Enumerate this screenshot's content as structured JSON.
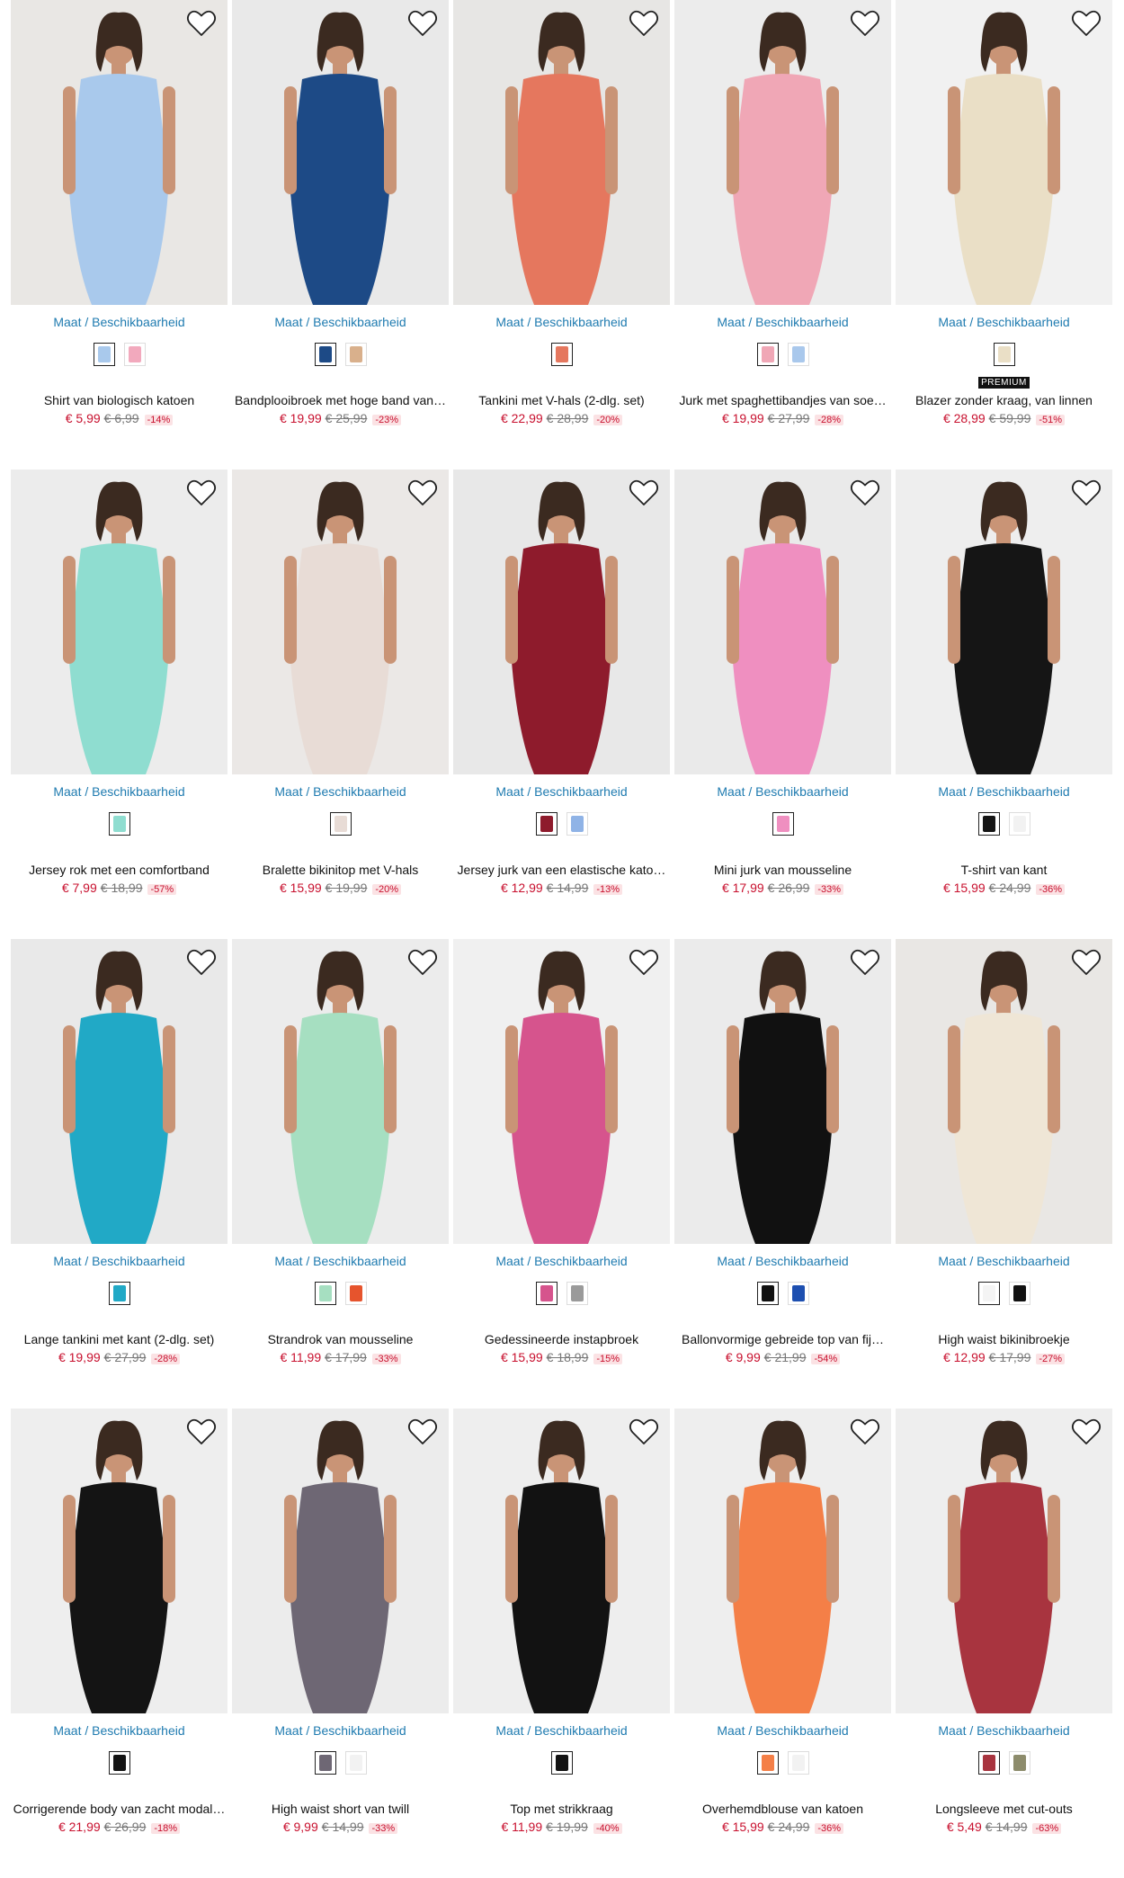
{
  "availability_label": "Maat / Beschikbaarheid",
  "products": [
    {
      "name": "Shirt van biologisch katoen",
      "price": "€ 5,99",
      "old_price": "€ 6,99",
      "discount": "-14%",
      "bg": "#e9e7e4",
      "garment": "#a9c9ec",
      "swatches": [
        "#a9c9ec",
        "#f2a9bd"
      ]
    },
    {
      "name": "Bandplooibroek met hoge band van…",
      "price": "€ 19,99",
      "old_price": "€ 25,99",
      "discount": "-23%",
      "bg": "#e9e9e9",
      "garment": "#1d4a86",
      "swatches": [
        "#1d4a86",
        "#d9b08c"
      ]
    },
    {
      "name": "Tankini met V-hals (2-dlg. set)",
      "price": "€ 22,99",
      "old_price": "€ 28,99",
      "discount": "-20%",
      "bg": "#e7e6e4",
      "garment": "#e5775e",
      "swatches": [
        "#e5775e"
      ]
    },
    {
      "name": "Jurk met spaghettibandjes van soe…",
      "price": "€ 19,99",
      "old_price": "€ 27,99",
      "discount": "-28%",
      "bg": "#ececec",
      "garment": "#f0a7b6",
      "swatches": [
        "#f0a7b6",
        "#a9c8ec"
      ]
    },
    {
      "name": "Blazer zonder kraag, van linnen",
      "price": "€ 28,99",
      "old_price": "€ 59,99",
      "discount": "-51%",
      "badge": "PREMIUM",
      "bg": "#f1f1f1",
      "garment": "#eadfc6",
      "swatches": [
        "#eadfc6"
      ]
    },
    {
      "name": "Jersey rok met een comfortband",
      "price": "€ 7,99",
      "old_price": "€ 18,99",
      "discount": "-57%",
      "bg": "#ececec",
      "garment": "#8fddd0",
      "swatches": [
        "#8fddd0"
      ]
    },
    {
      "name": "Bralette bikinitop met V-hals",
      "price": "€ 15,99",
      "old_price": "€ 19,99",
      "discount": "-20%",
      "bg": "#ebe8e6",
      "garment": "#e8dcd6",
      "swatches": [
        "#e8dcd6"
      ]
    },
    {
      "name": "Jersey jurk van een elastische kato…",
      "price": "€ 12,99",
      "old_price": "€ 14,99",
      "discount": "-13%",
      "bg": "#e8e8e8",
      "garment": "#8e1b2c",
      "swatches": [
        "#8e1b2c",
        "#8fb3e6"
      ]
    },
    {
      "name": "Mini jurk van mousseline",
      "price": "€ 17,99",
      "old_price": "€ 26,99",
      "discount": "-33%",
      "bg": "#eaeaea",
      "garment": "#ef8fc0",
      "swatches": [
        "#ef8fc0"
      ]
    },
    {
      "name": "T-shirt van kant",
      "price": "€ 15,99",
      "old_price": "€ 24,99",
      "discount": "-36%",
      "bg": "#eeeeee",
      "garment": "#151515",
      "swatches": [
        "#151515",
        "#f2f2f2"
      ]
    },
    {
      "name": "Lange tankini met kant (2-dlg. set)",
      "price": "€ 19,99",
      "old_price": "€ 27,99",
      "discount": "-28%",
      "bg": "#e9e9e9",
      "garment": "#21a9c6",
      "swatches": [
        "#21a9c6"
      ]
    },
    {
      "name": "Strandrok van mousseline",
      "price": "€ 11,99",
      "old_price": "€ 17,99",
      "discount": "-33%",
      "bg": "#ececec",
      "garment": "#a6dfc1",
      "swatches": [
        "#a6dfc1",
        "#e6542d"
      ]
    },
    {
      "name": "Gedessineerde instapbroek",
      "price": "€ 15,99",
      "old_price": "€ 18,99",
      "discount": "-15%",
      "bg": "#f0f0f0",
      "garment": "#d6548d",
      "swatches": [
        "#d6548d",
        "#9a9a9a"
      ]
    },
    {
      "name": "Ballonvormige gebreide top van fij…",
      "price": "€ 9,99",
      "old_price": "€ 21,99",
      "discount": "-54%",
      "bg": "#ebebeb",
      "garment": "#111111",
      "swatches": [
        "#111111",
        "#1d4fb0"
      ]
    },
    {
      "name": "High waist bikinibroekje",
      "price": "€ 12,99",
      "old_price": "€ 17,99",
      "discount": "-27%",
      "bg": "#e9e7e4",
      "garment": "#efe6d6",
      "swatches": [
        "#f4f4f4",
        "#111111"
      ]
    },
    {
      "name": "Corrigerende body van zacht modal…",
      "price": "€ 21,99",
      "old_price": "€ 26,99",
      "discount": "-18%",
      "bg": "#eeeeee",
      "garment": "#141414",
      "swatches": [
        "#141414"
      ]
    },
    {
      "name": "High waist short van twill",
      "price": "€ 9,99",
      "old_price": "€ 14,99",
      "discount": "-33%",
      "bg": "#ececec",
      "garment": "#6e6774",
      "swatches": [
        "#6e6774",
        "#f2f2f2"
      ]
    },
    {
      "name": "Top met strikkraag",
      "price": "€ 11,99",
      "old_price": "€ 19,99",
      "discount": "-40%",
      "bg": "#eeeeee",
      "garment": "#121212",
      "swatches": [
        "#121212"
      ]
    },
    {
      "name": "Overhemdblouse van katoen",
      "price": "€ 15,99",
      "old_price": "€ 24,99",
      "discount": "-36%",
      "bg": "#eeeeee",
      "garment": "#f47f47",
      "swatches": [
        "#f47f47",
        "#f2f2f2"
      ]
    },
    {
      "name": "Longsleeve met cut-outs",
      "price": "€ 5,49",
      "old_price": "€ 14,99",
      "discount": "-63%",
      "bg": "#eeeeee",
      "garment": "#a8343f",
      "swatches": [
        "#a8343f",
        "#8d8c6c"
      ]
    }
  ],
  "icons": {
    "favorite": "heart-outline-icon"
  }
}
